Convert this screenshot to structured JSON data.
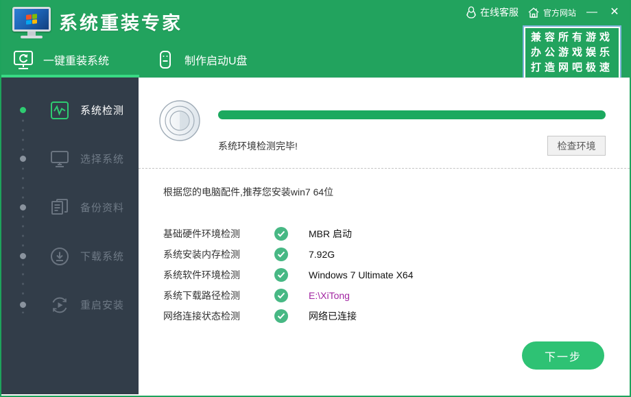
{
  "window": {
    "title": "系统重装专家",
    "minimize_label": "—",
    "close_label": "✕"
  },
  "top_links": {
    "online_service": "在线客服",
    "official_site": "官方网站"
  },
  "promo": {
    "lines": [
      "兼容所有游戏",
      "办公游戏娱乐",
      "打造网吧极速"
    ]
  },
  "tabs": [
    {
      "label": "一键重装系统",
      "active": true
    },
    {
      "label": "制作启动U盘",
      "active": false
    }
  ],
  "sidebar": {
    "steps": [
      {
        "label": "系统检测",
        "active": true
      },
      {
        "label": "选择系统",
        "active": false
      },
      {
        "label": "备份资料",
        "active": false
      },
      {
        "label": "下载系统",
        "active": false
      },
      {
        "label": "重启安装",
        "active": false
      }
    ]
  },
  "detection": {
    "progress_percent": 100,
    "status_text": "系统环境检测完毕!",
    "check_env_button": "检查环境"
  },
  "main": {
    "recommendation": "根据您的电脑配件,推荐您安装win7 64位",
    "checks": [
      {
        "label": "基础硬件环境检测",
        "value": "MBR 启动"
      },
      {
        "label": "系统安装内存检测",
        "value": "7.92G"
      },
      {
        "label": "系统软件环境检测",
        "value": "Windows 7 Ultimate X64"
      },
      {
        "label": "系统下载路径检测",
        "value": "E:\\XiTong"
      },
      {
        "label": "网络连接状态检测",
        "value": "网络已连接"
      }
    ],
    "next_button": "下一步"
  },
  "colors": {
    "header_green": "#22a35e",
    "underline_green": "#39d983",
    "sidebar_dark": "#323d49",
    "progress_green": "#1ca95f",
    "check_green": "#47b884",
    "next_button_green": "#2ec274",
    "path_purple": "#a226a2"
  }
}
